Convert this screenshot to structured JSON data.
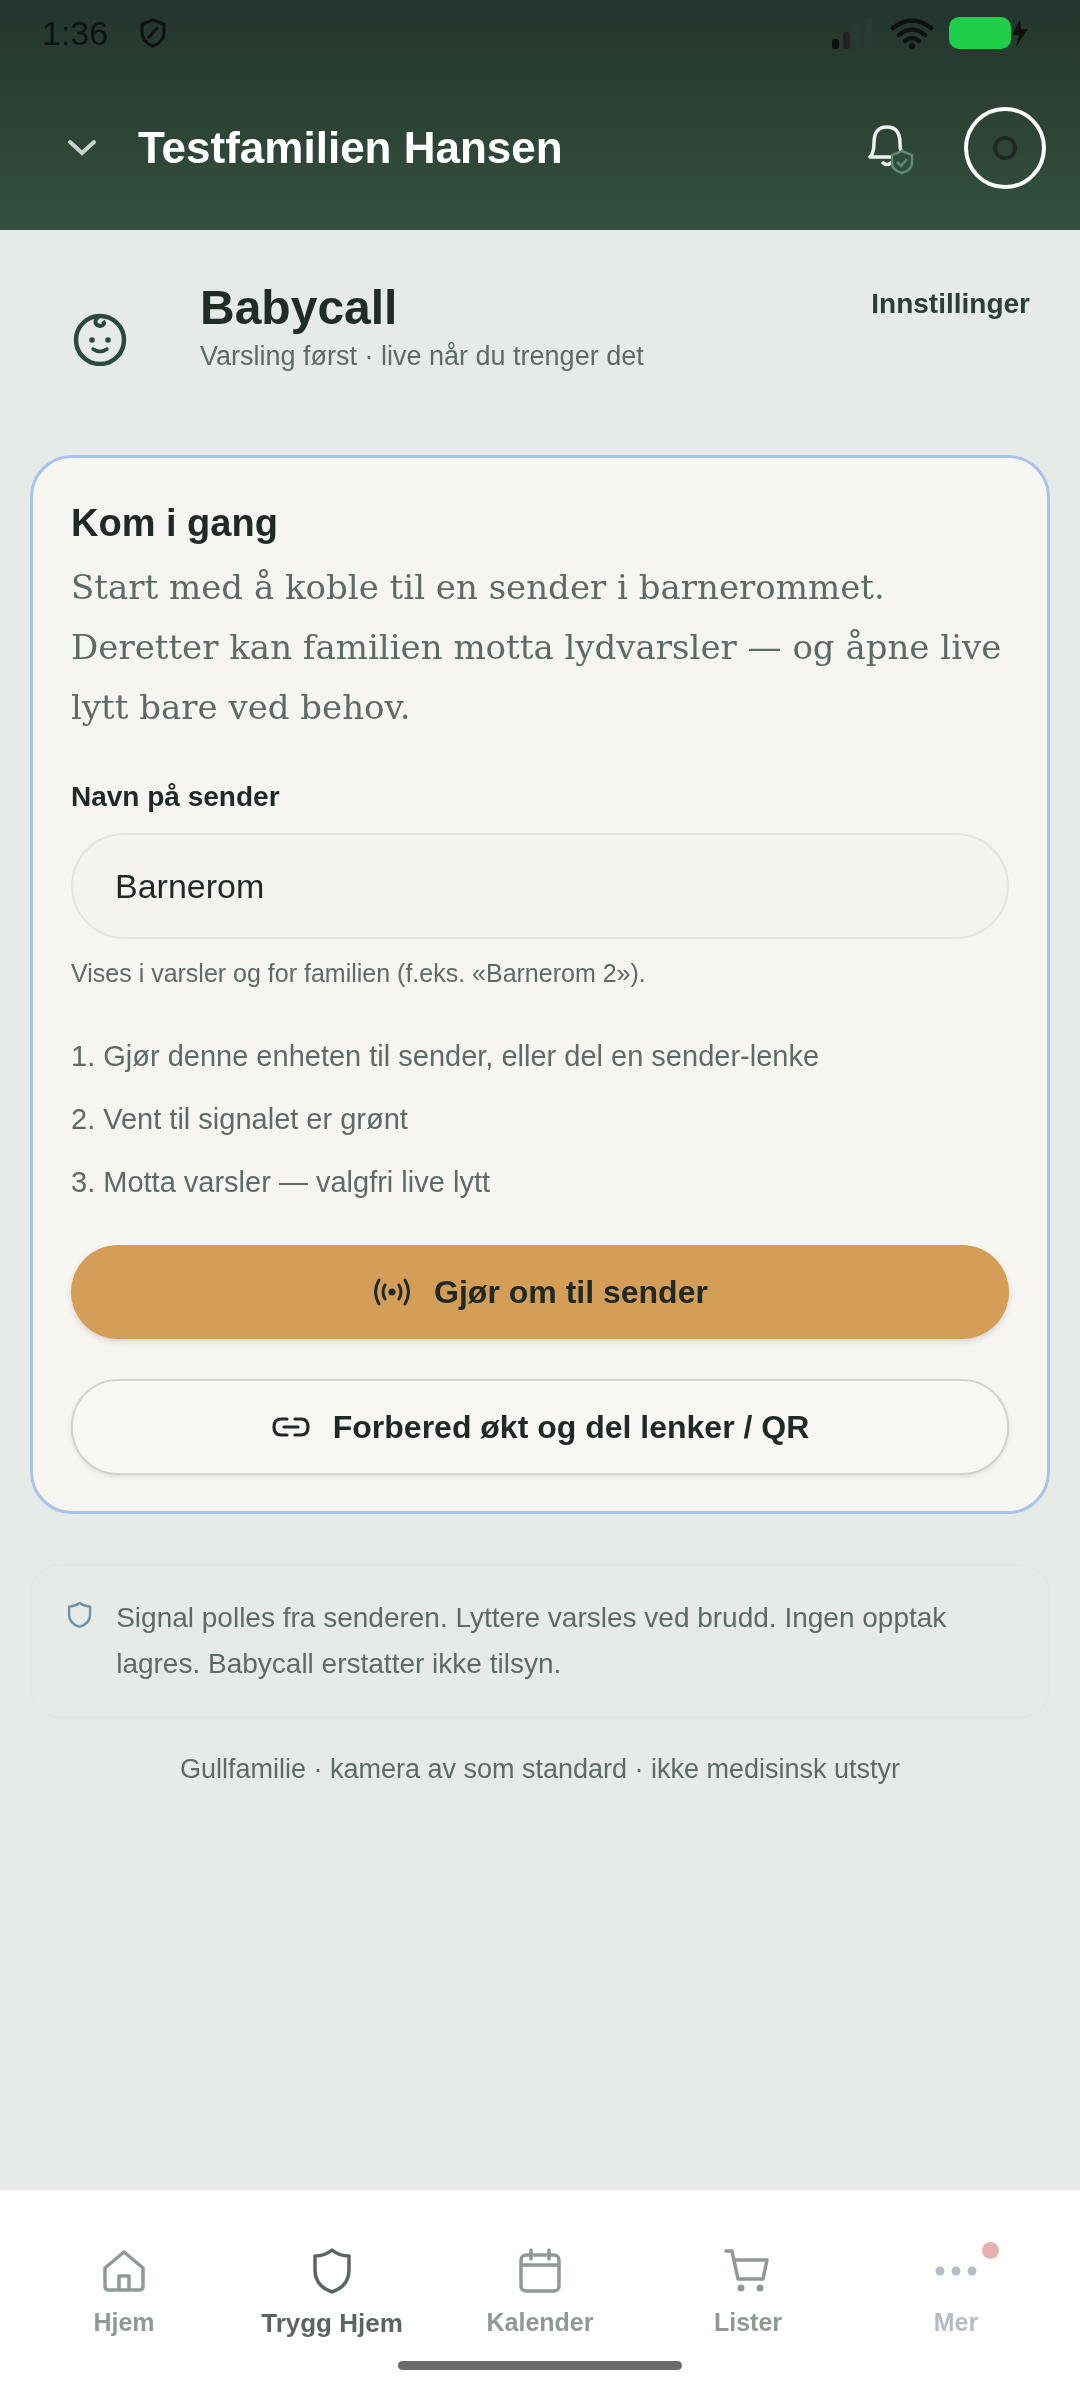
{
  "status_bar": {
    "time": "1:36"
  },
  "header": {
    "family": "Testfamilien Hansen"
  },
  "section": {
    "title": "Babycall",
    "subtitle": "Varsling først · live når du trenger det",
    "settings_link": "Innstillinger"
  },
  "card": {
    "title": "Kom i gang",
    "intro": "Start med å koble til en sender i barnerommet. Deretter kan familien motta lydvarsler — og åpne live lytt bare ved behov.",
    "field": {
      "label": "Navn på sender",
      "value": "Barnerom",
      "hint": "Vises i varsler og for familien (f.eks. «Barnerom 2»)."
    },
    "steps": [
      "1. Gjør denne enheten til sender, eller del en sender-lenke",
      "2. Vent til signalet er grønt",
      "3. Motta varsler — valgfri live lytt"
    ],
    "buttons": [
      {
        "kind": "primary",
        "label": "Gjør om til sender"
      },
      {
        "kind": "secondary",
        "label": "Forbered økt og del lenker / QR"
      }
    ]
  },
  "notice": "Signal polles fra senderen. Lyttere varsles ved brudd. Ingen opptak lagres. Babycall erstatter ikke tilsyn.",
  "footer": "Gullfamilie · kamera av som standard · ikke medisinsk utstyr",
  "nav": [
    {
      "kind": "home",
      "label": "Hjem",
      "selected": false,
      "disabled": false,
      "dot": false
    },
    {
      "kind": "shield",
      "label": "Trygg Hjem",
      "selected": true,
      "disabled": false,
      "dot": false
    },
    {
      "kind": "calendar",
      "label": "Kalender",
      "selected": false,
      "disabled": false,
      "dot": false
    },
    {
      "kind": "cart",
      "label": "Lister",
      "selected": false,
      "disabled": false,
      "dot": false
    },
    {
      "kind": "more",
      "label": "Mer",
      "selected": false,
      "disabled": true,
      "dot": true
    }
  ]
}
